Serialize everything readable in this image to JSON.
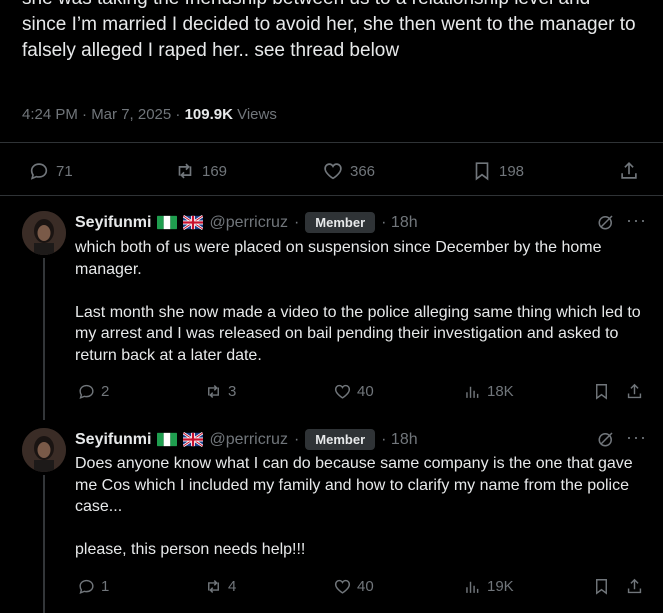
{
  "main_tweet": {
    "lines": [
      "she was taking the friendship between us to a relationship level and",
      "since I’m married I decided to avoid her, she then went to the manager to",
      "falsely alleged I raped her.. see thread below"
    ],
    "time": "4:24 PM · Mar 7, 2025 · ",
    "views": "109.9K",
    "views_label": " Views",
    "stats": {
      "replies": "71",
      "reposts": "169",
      "likes": "366",
      "bookmarks": "198"
    }
  },
  "replies": [
    {
      "name": "Seyifunmi",
      "handle": "@perricruz",
      "sep": "·",
      "badge": "Member",
      "time": "· 18h",
      "paragraphs": [
        "which both of us were placed on suspension since December by the home manager.",
        "Last month she now made a video to the police alleging same thing which led to my arrest and I was released on bail pending their investigation and asked to return back at a later date."
      ],
      "stats": {
        "replies": "2",
        "reposts": "3",
        "likes": "40",
        "views": "18K"
      }
    },
    {
      "name": "Seyifunmi",
      "handle": "@perricruz",
      "sep": "·",
      "badge": "Member",
      "time": "· 18h",
      "paragraphs": [
        "Does anyone know what I can do because same company is the one that gave me Cos which I included my family and how to clarify my name from the police case...",
        "please, this person needs help!!!"
      ],
      "stats": {
        "replies": "1",
        "reposts": "4",
        "likes": "40",
        "views": "19K"
      }
    }
  ],
  "icons": {
    "reply": "speech-bubble-icon",
    "repost": "repost-arrows-icon",
    "like": "heart-icon",
    "bookmark": "bookmark-icon",
    "share": "share-upload-icon",
    "views": "bar-chart-icon",
    "grok": "grok-icon",
    "more": "more-dots-icon"
  },
  "colors": {
    "background": "#000000",
    "text": "#e7e9ea",
    "muted": "#71767b",
    "divider": "#2f3336"
  }
}
